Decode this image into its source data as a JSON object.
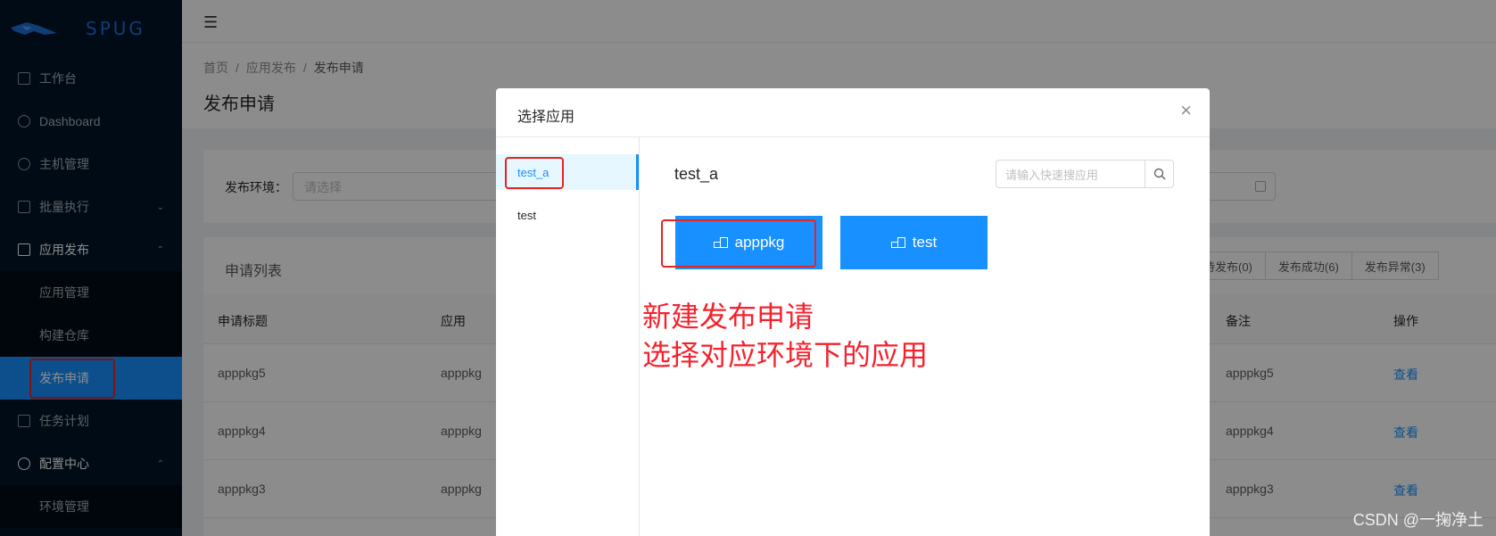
{
  "brand": {
    "name": "SPUG"
  },
  "sidebar": {
    "items": [
      {
        "label": "工作台",
        "icon": "desktop-icon"
      },
      {
        "label": "Dashboard",
        "icon": "dashboard-icon"
      },
      {
        "label": "主机管理",
        "icon": "cloud-icon"
      },
      {
        "label": "批量执行",
        "icon": "code-icon"
      },
      {
        "label": "应用发布",
        "icon": "flag-icon"
      },
      {
        "label": "任务计划",
        "icon": "schedule-icon"
      },
      {
        "label": "配置中心",
        "icon": "cluster-icon"
      }
    ],
    "deploy_sub": [
      {
        "label": "应用管理"
      },
      {
        "label": "构建仓库"
      },
      {
        "label": "发布申请"
      }
    ],
    "config_sub": [
      {
        "label": "环境管理"
      }
    ],
    "active_color": "#1890ff"
  },
  "breadcrumb": [
    "首页",
    "应用发布",
    "发布申请"
  ],
  "page_title": "发布申请",
  "filter": {
    "env_label": "发布环境：",
    "env_placeholder": "请选择"
  },
  "list": {
    "title": "申请列表",
    "status_tabs": [
      "待发布(0)",
      "发布成功(6)",
      "发布异常(3)"
    ],
    "columns": {
      "title": "申请标题",
      "app": "应用",
      "remark": "备注",
      "action": "操作"
    },
    "rows": [
      {
        "title": "apppkg5",
        "app": "apppkg",
        "remark": "apppkg5",
        "action": "查看"
      },
      {
        "title": "apppkg4",
        "app": "apppkg",
        "remark": "apppkg4",
        "action": "查看"
      },
      {
        "title": "apppkg3",
        "app": "apppkg",
        "remark": "apppkg3",
        "action": "查看"
      }
    ]
  },
  "modal": {
    "title": "选择应用",
    "close_symbol": "×",
    "envs": [
      {
        "label": "test_a"
      },
      {
        "label": "test"
      }
    ],
    "selected_env": "test_a",
    "search_placeholder": "请输入快速搜应用",
    "apps": [
      {
        "label": "apppkg"
      },
      {
        "label": "test"
      }
    ]
  },
  "annotation": {
    "line1": "新建发布申请",
    "line2": "选择对应环境下的应用",
    "color": "#f5222d"
  },
  "watermark": "CSDN @一掬净土"
}
